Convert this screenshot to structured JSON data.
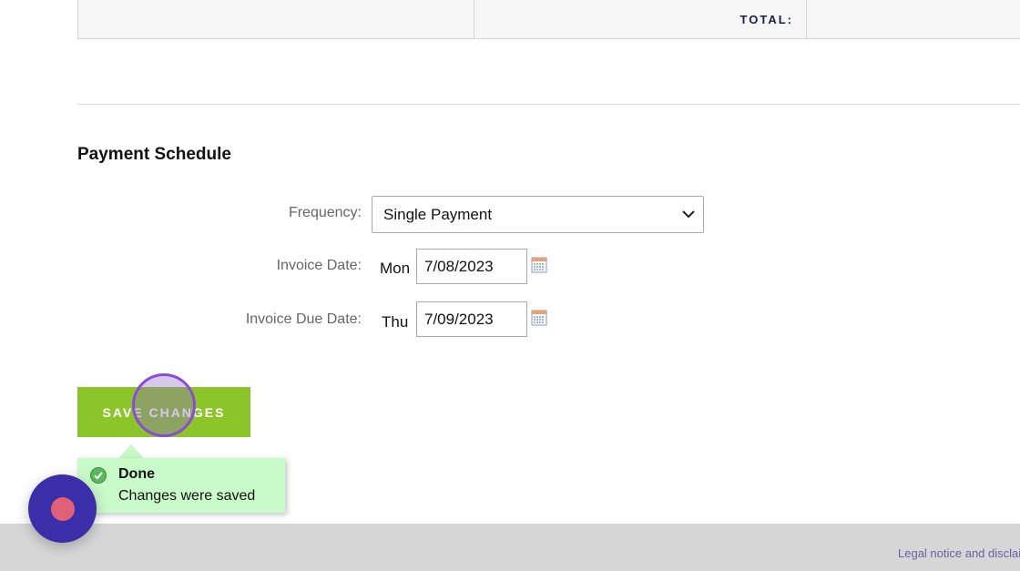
{
  "totals": {
    "total_label": "TOTAL:"
  },
  "payment_schedule": {
    "title": "Payment Schedule",
    "frequency": {
      "label": "Frequency:",
      "value": "Single Payment"
    },
    "invoice_date": {
      "label": "Invoice Date:",
      "day": "Mon",
      "value": "7/08/2023"
    },
    "invoice_due_date": {
      "label": "Invoice Due Date:",
      "day": "Thu",
      "value": "7/09/2023"
    }
  },
  "actions": {
    "save_label": "SAVE CHANGES"
  },
  "toast": {
    "title": "Done",
    "message": "Changes were saved",
    "icon": "check-circle-icon"
  },
  "footer": {
    "legal_link": "Legal notice and disclaimer"
  },
  "widget": {
    "icon": "record-icon"
  },
  "colors": {
    "save_button": "#8cc52a",
    "toast_background": "#c9fac9",
    "widget_background": "#3a2fa8",
    "widget_dot": "#e0607a",
    "footer_link": "#6b5fa8"
  }
}
